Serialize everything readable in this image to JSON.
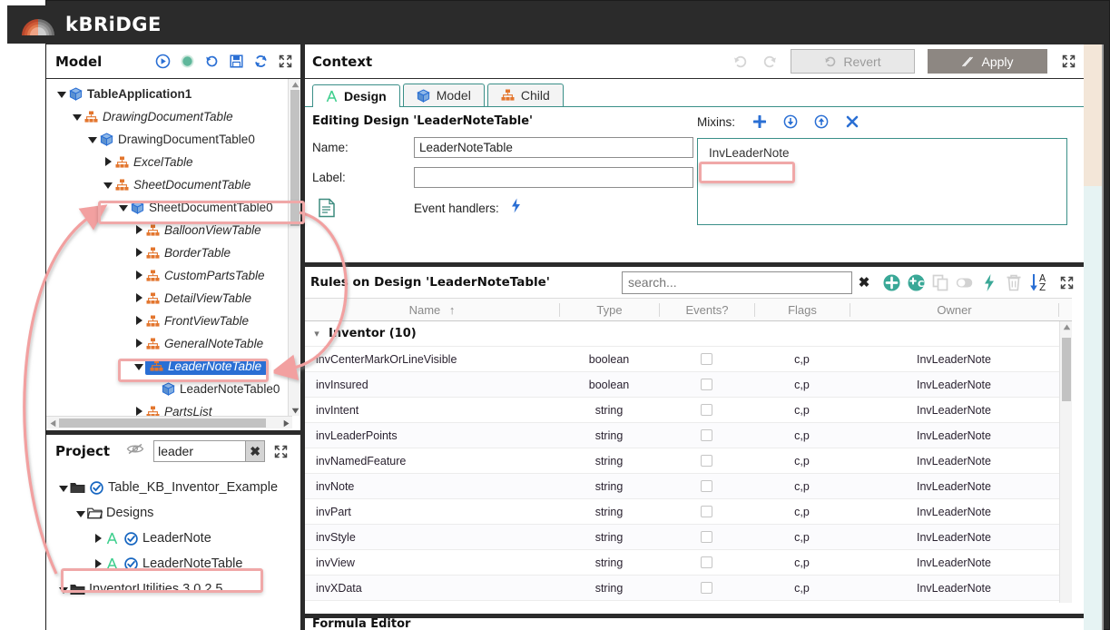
{
  "app": {
    "brand": "kBRiDGE",
    "brand_accent_color": "#e8673a"
  },
  "model_panel": {
    "title": "Model",
    "tools": [
      {
        "name": "run-icon",
        "glyph": "▶"
      },
      {
        "name": "status-dot-icon",
        "glyph": "●"
      },
      {
        "name": "history-icon",
        "glyph": "↺"
      },
      {
        "name": "save-icon",
        "glyph": "💾"
      },
      {
        "name": "refresh-icon",
        "glyph": "⟳"
      },
      {
        "name": "expand-icon",
        "glyph": "⤢"
      }
    ],
    "tree": [
      {
        "label": "TableApplication1",
        "depth": 0,
        "caret": "down",
        "icon": "cube",
        "italic": false,
        "bold": true
      },
      {
        "label": "DrawingDocumentTable",
        "depth": 1,
        "caret": "down",
        "icon": "hierarchy",
        "italic": true,
        "bold": false
      },
      {
        "label": "DrawingDocumentTable0",
        "depth": 2,
        "caret": "down",
        "icon": "cube",
        "italic": false,
        "bold": false
      },
      {
        "label": "ExcelTable",
        "depth": 3,
        "caret": "right",
        "icon": "hierarchy",
        "italic": true,
        "bold": false
      },
      {
        "label": "SheetDocumentTable",
        "depth": 3,
        "caret": "down",
        "icon": "hierarchy",
        "italic": true,
        "bold": false
      },
      {
        "label": "SheetDocumentTable0",
        "depth": 4,
        "caret": "down",
        "icon": "cube",
        "italic": false,
        "bold": false
      },
      {
        "label": "BalloonViewTable",
        "depth": 5,
        "caret": "right",
        "icon": "hierarchy",
        "italic": true,
        "bold": false
      },
      {
        "label": "BorderTable",
        "depth": 5,
        "caret": "right",
        "icon": "hierarchy",
        "italic": true,
        "bold": false
      },
      {
        "label": "CustomPartsTable",
        "depth": 5,
        "caret": "right",
        "icon": "hierarchy",
        "italic": true,
        "bold": false
      },
      {
        "label": "DetailViewTable",
        "depth": 5,
        "caret": "right",
        "icon": "hierarchy",
        "italic": true,
        "bold": false
      },
      {
        "label": "FrontViewTable",
        "depth": 5,
        "caret": "right",
        "icon": "hierarchy",
        "italic": true,
        "bold": false
      },
      {
        "label": "GeneralNoteTable",
        "depth": 5,
        "caret": "right",
        "icon": "hierarchy",
        "italic": true,
        "bold": false
      },
      {
        "label": "LeaderNoteTable",
        "depth": 5,
        "caret": "down",
        "icon": "hierarchy",
        "italic": true,
        "bold": false,
        "selected": true
      },
      {
        "label": "LeaderNoteTable0",
        "depth": 6,
        "caret": "none",
        "icon": "cube",
        "italic": false,
        "bold": false
      },
      {
        "label": "PartsList",
        "depth": 5,
        "caret": "right",
        "icon": "hierarchy",
        "italic": true,
        "bold": false
      }
    ]
  },
  "project_panel": {
    "title": "Project",
    "filter_icon": "eye-slash-icon",
    "search_value": "leader",
    "clear_label": "✖",
    "expand_icon": "expand-icon",
    "tree": [
      {
        "label": "Table_KB_Inventor_Example",
        "depth": 0,
        "caret": "down",
        "icon": "folder-open-solid",
        "check": true
      },
      {
        "label": "Designs",
        "depth": 1,
        "caret": "down",
        "icon": "folder-open",
        "check": false
      },
      {
        "label": "LeaderNote",
        "depth": 2,
        "caret": "right",
        "icon": "design-A",
        "check": true
      },
      {
        "label": "LeaderNoteTable",
        "depth": 2,
        "caret": "right",
        "icon": "design-A",
        "check": true
      },
      {
        "label": "InventorUtilities 3.0.2.5",
        "depth": 0,
        "caret": "down",
        "icon": "folder-open-solid",
        "check": false
      }
    ]
  },
  "context_panel": {
    "title": "Context",
    "undo_icon": "undo-icon",
    "redo_icon": "redo-icon",
    "revert_label": "Revert",
    "apply_label": "Apply",
    "expand_icon": "expand-icon",
    "tabs": [
      {
        "label": "Design",
        "icon": "design-A-icon",
        "active": true
      },
      {
        "label": "Model",
        "icon": "cube-icon",
        "active": false
      },
      {
        "label": "Child",
        "icon": "hierarchy-icon",
        "active": false
      }
    ],
    "editing_line": "Editing Design 'LeaderNoteTable'",
    "name_label": "Name:",
    "name_value": "LeaderNoteTable",
    "label_label": "Label:",
    "label_value": "",
    "label_placeholder": "",
    "event_handlers_label": "Event handlers:",
    "event_handlers_icon": "lightning-icon",
    "document_icon": "document-icon",
    "mixins_label": "Mixins:",
    "mixins_buttons": [
      {
        "name": "mixin-add-icon",
        "glyph": "✚"
      },
      {
        "name": "mixin-move-down-icon",
        "glyph": "⬇"
      },
      {
        "name": "mixin-move-up-icon",
        "glyph": "⬆"
      },
      {
        "name": "mixin-remove-icon",
        "glyph": "✖"
      }
    ],
    "mixins": [
      "InvLeaderNote"
    ]
  },
  "rules_panel": {
    "title": "Rules on Design 'LeaderNoteTable'",
    "search_placeholder": "search...",
    "search_clear": "✖",
    "toolbar_icons": [
      {
        "name": "add-rule-icon",
        "glyph": "+"
      },
      {
        "name": "add-child-rule-icon",
        "glyph": "+C"
      },
      {
        "name": "copy-rule-icon",
        "glyph": "copy"
      },
      {
        "name": "toggle-rule-icon",
        "glyph": "toggle"
      },
      {
        "name": "event-rule-icon",
        "glyph": "lightning"
      },
      {
        "name": "delete-rule-icon",
        "glyph": "trash"
      },
      {
        "name": "sort-az-icon",
        "glyph": "AZ"
      },
      {
        "name": "expand-icon",
        "glyph": "expand"
      }
    ],
    "columns": [
      "Name",
      "Type",
      "Events?",
      "Flags",
      "Owner"
    ],
    "sort_column": "Name",
    "sort_direction": "↑",
    "group": {
      "label": "Inventor (10)",
      "expanded": true
    },
    "rows": [
      {
        "name": "invCenterMarkOrLineVisible",
        "type": "boolean",
        "events": false,
        "flags": "c,p",
        "owner": "InvLeaderNote"
      },
      {
        "name": "invInsured",
        "type": "boolean",
        "events": false,
        "flags": "c,p",
        "owner": "InvLeaderNote"
      },
      {
        "name": "invIntent",
        "type": "string",
        "events": false,
        "flags": "c,p",
        "owner": "InvLeaderNote"
      },
      {
        "name": "invLeaderPoints",
        "type": "string",
        "events": false,
        "flags": "c,p",
        "owner": "InvLeaderNote"
      },
      {
        "name": "invNamedFeature",
        "type": "string",
        "events": false,
        "flags": "c,p",
        "owner": "InvLeaderNote"
      },
      {
        "name": "invNote",
        "type": "string",
        "events": false,
        "flags": "c,p",
        "owner": "InvLeaderNote"
      },
      {
        "name": "invPart",
        "type": "string",
        "events": false,
        "flags": "c,p",
        "owner": "InvLeaderNote"
      },
      {
        "name": "invStyle",
        "type": "string",
        "events": false,
        "flags": "c,p",
        "owner": "InvLeaderNote"
      },
      {
        "name": "invView",
        "type": "string",
        "events": false,
        "flags": "c,p",
        "owner": "InvLeaderNote"
      },
      {
        "name": "invXData",
        "type": "string",
        "events": false,
        "flags": "c,p",
        "owner": "InvLeaderNote"
      }
    ]
  },
  "formula_editor": {
    "title": "Formula Editor"
  },
  "annotations": {
    "highlight_color": "#f0a8a8",
    "arrow_color": "#f2a0a0",
    "highlights": [
      {
        "target": "SheetDocumentTable0"
      },
      {
        "target": "LeaderNoteTable (model tree)"
      },
      {
        "target": "LeaderNoteTable (project tree)"
      },
      {
        "target": "InvLeaderNote (mixins)"
      }
    ]
  }
}
